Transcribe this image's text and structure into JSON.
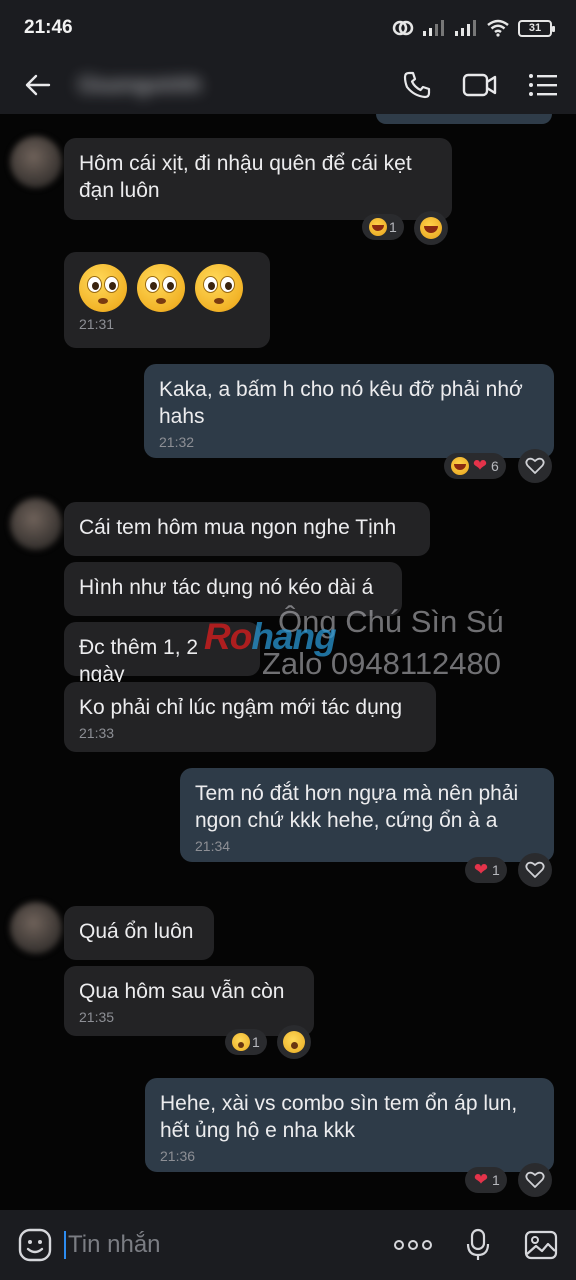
{
  "status_bar": {
    "time": "21:46",
    "battery": "31"
  },
  "header": {
    "contact_name": "Giuongvinhh"
  },
  "messages": [
    {
      "text": "Hôm cái xịt, đi nhậu quên để cái kẹt\nđạn luôn",
      "time": ""
    },
    {
      "text": "",
      "time": "21:31"
    },
    {
      "text": "Kaka, a bấm h cho nó kêu đỡ phải nhớ\nhahs",
      "time": "21:32"
    },
    {
      "text": "Cái tem hôm mua ngon nghe Tịnh",
      "time": ""
    },
    {
      "text": "Hình như tác dụng nó kéo dài á",
      "time": ""
    },
    {
      "text": "Đc thêm 1, 2 ngày",
      "time": ""
    },
    {
      "text": "Ko phải chỉ lúc ngậm mới tác dụng",
      "time": "21:33"
    },
    {
      "text": "Tem nó đắt hơn ngựa mà nên phải\nngon chứ kkk hehe, cứng ổn à a",
      "time": "21:34"
    },
    {
      "text": "Quá ổn luôn",
      "time": ""
    },
    {
      "text": "Qua hôm sau vẫn còn",
      "time": "21:35"
    },
    {
      "text": "Hehe, xài vs combo sìn tem ổn áp lun,\nhết ủng hộ e nha kkk",
      "time": "21:36"
    }
  ],
  "reactions": [
    {
      "emoji": "laugh-emoji",
      "count": "1"
    },
    {
      "emoji": "laugh-heart-emoji",
      "count": "6"
    },
    {
      "emoji": "heart-emoji",
      "count": "1"
    },
    {
      "emoji": "wow-emoji",
      "count": "1"
    },
    {
      "emoji": "heart-emoji",
      "count": "1"
    }
  ],
  "watermark": {
    "name": "Ông Chú Sìn Sú",
    "logo_part1": "Ro",
    "logo_part2": "hang",
    "zalo": "Zalo 0948112480"
  },
  "input": {
    "placeholder": "Tin nhắn"
  },
  "colors": {
    "bar_bg": "#1b1c20",
    "incoming_bubble": "#232325",
    "outgoing_bubble": "#2e3b48",
    "caret": "#2d8cf0"
  }
}
